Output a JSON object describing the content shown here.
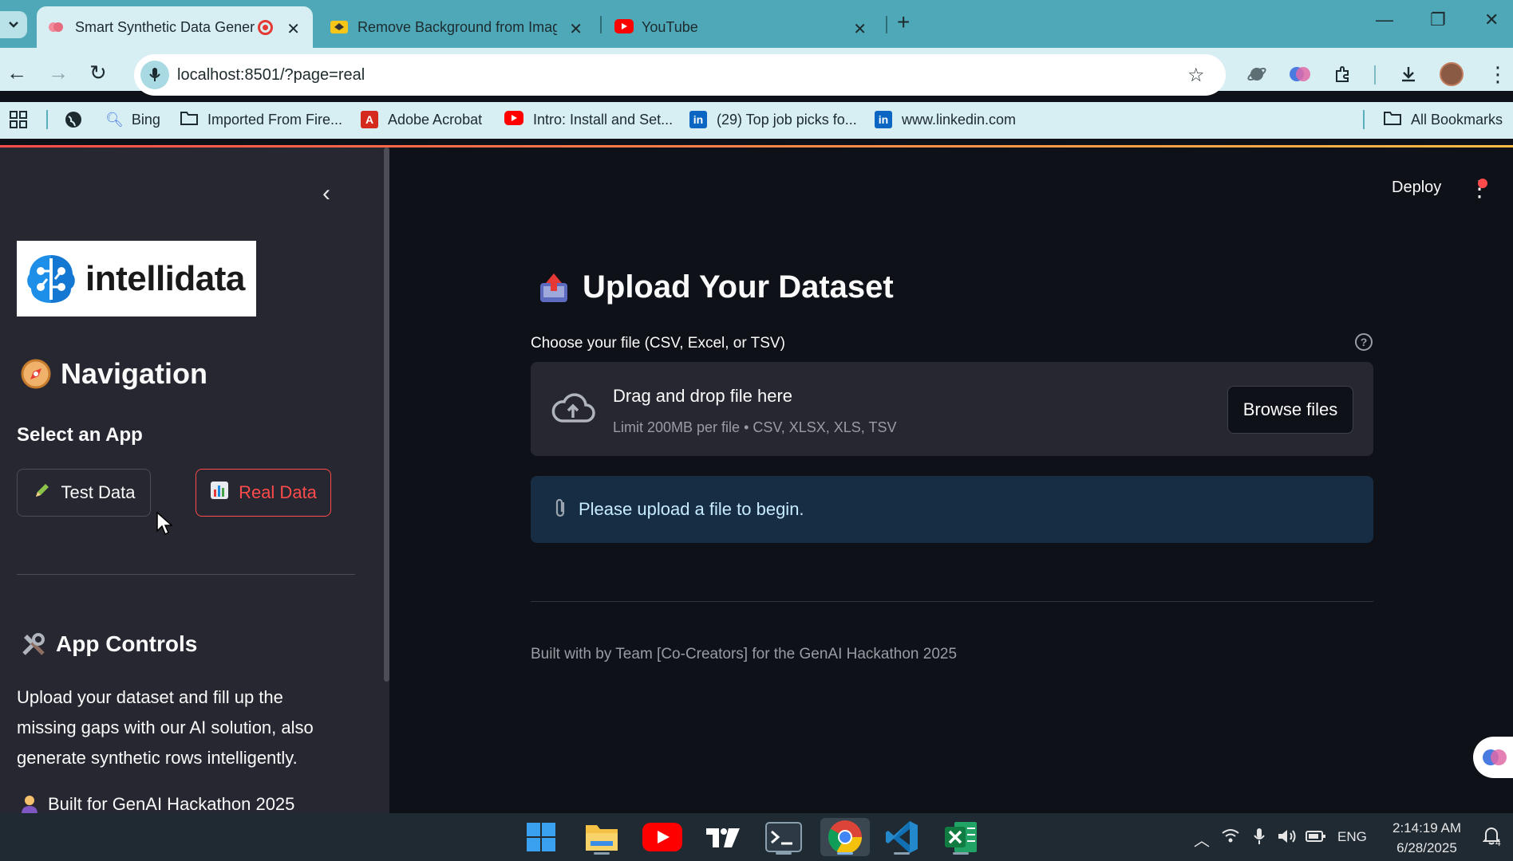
{
  "browser": {
    "tabs": [
      {
        "title": "Smart Synthetic Data Gener",
        "active": true,
        "recording": true
      },
      {
        "title": "Remove Background from Imag",
        "active": false
      },
      {
        "title": "YouTube",
        "active": false
      }
    ],
    "address": "localhost:8501/?page=real",
    "bookmarks": [
      {
        "label": "Bing"
      },
      {
        "label": "Imported From Fire..."
      },
      {
        "label": "Adobe Acrobat"
      },
      {
        "label": "Intro: Install and Set..."
      },
      {
        "label": "(29) Top job picks fo..."
      },
      {
        "label": "www.linkedin.com"
      },
      {
        "label": "All Bookmarks"
      }
    ]
  },
  "sidebar": {
    "logo_text": "intellidata",
    "nav_heading": "Navigation",
    "select_label": "Select an App",
    "buttons": {
      "test": "Test Data",
      "real": "Real Data"
    },
    "controls_heading": "App Controls",
    "controls_text_lines": [
      "Upload your dataset and fill up the",
      "missing gaps with our AI solution, also",
      "generate synthetic rows intelligently."
    ],
    "built_for": "Built for GenAI Hackathon 2025"
  },
  "main": {
    "deploy": "Deploy",
    "title": "Upload Your Dataset",
    "uploader_label": "Choose your file (CSV, Excel, or TSV)",
    "dropzone_title": "Drag and drop file here",
    "dropzone_sub": "Limit 200MB per file • CSV, XLSX, XLS, TSV",
    "browse": "Browse files",
    "info": "Please upload a file to begin.",
    "footer": "Built with by Team [Co-Creators] for the GenAI Hackathon 2025"
  },
  "taskbar": {
    "lang": "ENG",
    "time": "2:14:19 AM",
    "date": "6/28/2025",
    "notifications": "4"
  },
  "colors": {
    "accent": "#ff4b4b",
    "sidebar_bg": "#262730",
    "main_bg": "#0e1117",
    "info_bg": "#172d43",
    "browser_frame": "#4fa8b8"
  }
}
